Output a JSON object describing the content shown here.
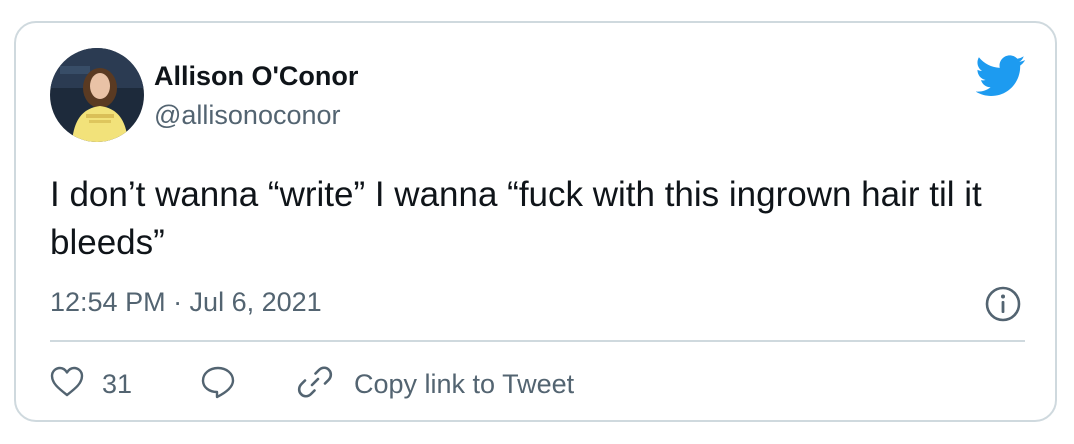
{
  "author": {
    "display_name": "Allison O'Conor",
    "handle": "@allisonoconor",
    "avatar_icon": "profile-photo",
    "avatar_colors": {
      "background": "#1d2a3b",
      "shirt": "#f2e27a",
      "hair": "#5a3a22",
      "skin": "#e9c2a6"
    }
  },
  "brand": {
    "icon": "twitter-bird-icon",
    "color": "#1d9bf0"
  },
  "tweet": {
    "text": "I don’t wanna “write” I wanna “fuck with this ingrown hair til it bleeds”",
    "timestamp": "12:54 PM · Jul 6, 2021"
  },
  "actions": {
    "like": {
      "icon": "heart-icon",
      "count": "31"
    },
    "reply": {
      "icon": "reply-bubble-icon"
    },
    "copy_link": {
      "icon": "link-icon",
      "label": "Copy link to Tweet"
    },
    "info": {
      "icon": "info-icon"
    }
  },
  "colors": {
    "text_primary": "#0f1419",
    "text_secondary": "#536471",
    "border": "#cfd9de",
    "accent": "#1d9bf0"
  }
}
